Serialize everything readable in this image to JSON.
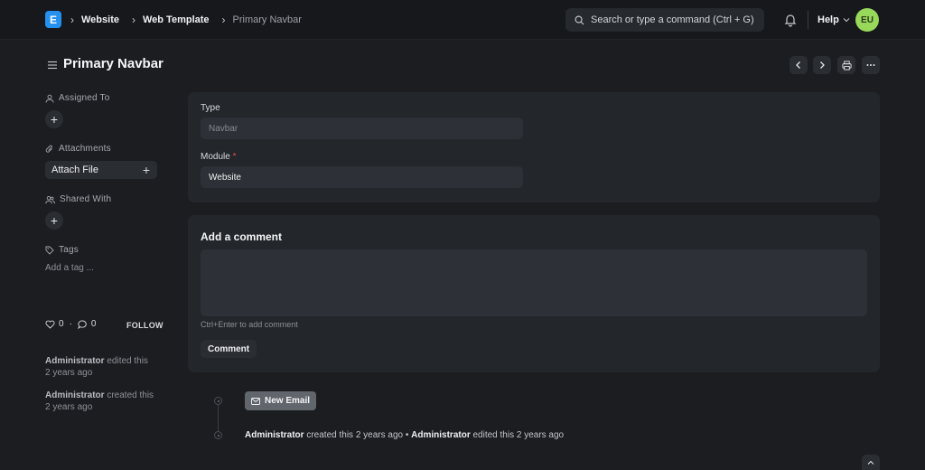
{
  "navbar": {
    "logo_letter": "E",
    "breadcrumbs": [
      "Website",
      "Web Template",
      "Primary Navbar"
    ],
    "search_placeholder": "Search or type a command (Ctrl + G)",
    "help_label": "Help",
    "avatar_initials": "EU"
  },
  "page": {
    "title": "Primary Navbar"
  },
  "sidebar": {
    "assigned_to_label": "Assigned To",
    "attachments_label": "Attachments",
    "attach_file_label": "Attach File",
    "shared_with_label": "Shared With",
    "tags_label": "Tags",
    "add_tag_label": "Add a tag ...",
    "likes_count": "0",
    "comments_count": "0",
    "follow_label": "FOLLOW",
    "activity": [
      {
        "user": "Administrator",
        "action": "edited this",
        "time": "2 years ago"
      },
      {
        "user": "Administrator",
        "action": "created this",
        "time": "2 years ago"
      }
    ]
  },
  "form": {
    "type_label": "Type",
    "type_value": "Navbar",
    "module_label": "Module",
    "module_required": "*",
    "module_value": "Website"
  },
  "comment": {
    "title": "Add a comment",
    "hint": "Ctrl+Enter to add comment",
    "button_label": "Comment"
  },
  "timeline": {
    "new_email_label": "New Email",
    "entry": {
      "user1": "Administrator",
      "action1": "created this 2 years ago",
      "separator": "•",
      "user2": "Administrator",
      "action2": "edited this 2 years ago"
    }
  }
}
